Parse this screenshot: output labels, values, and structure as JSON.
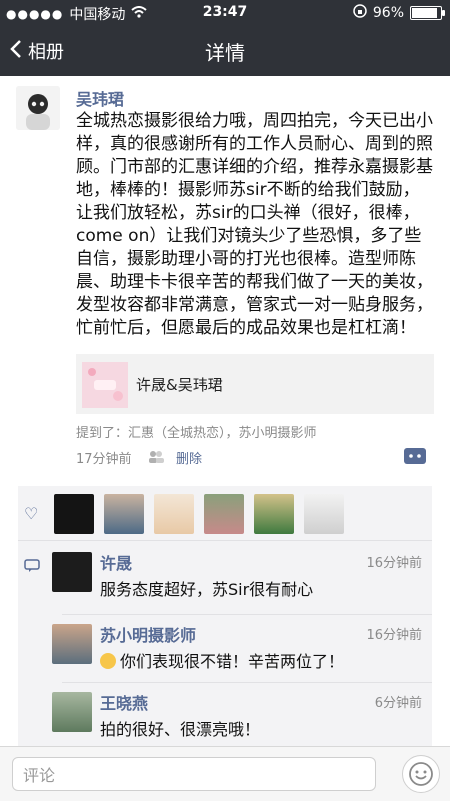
{
  "status": {
    "carrier": "中国移动",
    "time": "23:47",
    "battery_percent_text": "96%",
    "battery_level": 0.96
  },
  "nav": {
    "back_label": "相册",
    "title": "详情"
  },
  "post": {
    "author": "吴玮珺",
    "content": "全城热恋摄影很给力哦，周四拍完，今天已出小样，真的很感谢所有的工作人员耐心、周到的照顾。门市部的汇惠详细的介绍，推荐永嘉摄影基地，棒棒的！摄影师苏sir不断的给我们鼓励，让我们放轻松，苏sir的口头禅（很好，很棒，come on）让我们对镜头少了些恐惧，多了些自信，摄影助理小哥的打光也很棒。造型师陈晨、助理卡卡很辛苦的帮我们做了一天的美妆，发型妆容都非常满意，管家式一对一贴身服务，忙前忙后，但愿最后的成品效果也是杠杠滴！",
    "share_title": "许晟&吴玮珺",
    "mentions": "提到了：汇惠（全城热恋），苏小明摄影师",
    "time": "17分钟前",
    "delete_label": "删除"
  },
  "comments": [
    {
      "name": "许晟",
      "time": "16分钟前",
      "text": "服务态度超好，苏Sir很有耐心"
    },
    {
      "name": "苏小明摄影师",
      "time": "16分钟前",
      "text": "你们表现很不错！辛苦两位了！"
    },
    {
      "name": "王晓燕",
      "time": "6分钟前",
      "text": "拍的很好、很漂亮哦！"
    }
  ],
  "composer": {
    "placeholder": "评论"
  },
  "colors": {
    "header_bg": "#2f3238",
    "link_blue": "#576b95",
    "comment_bg": "#f3f3f5"
  }
}
